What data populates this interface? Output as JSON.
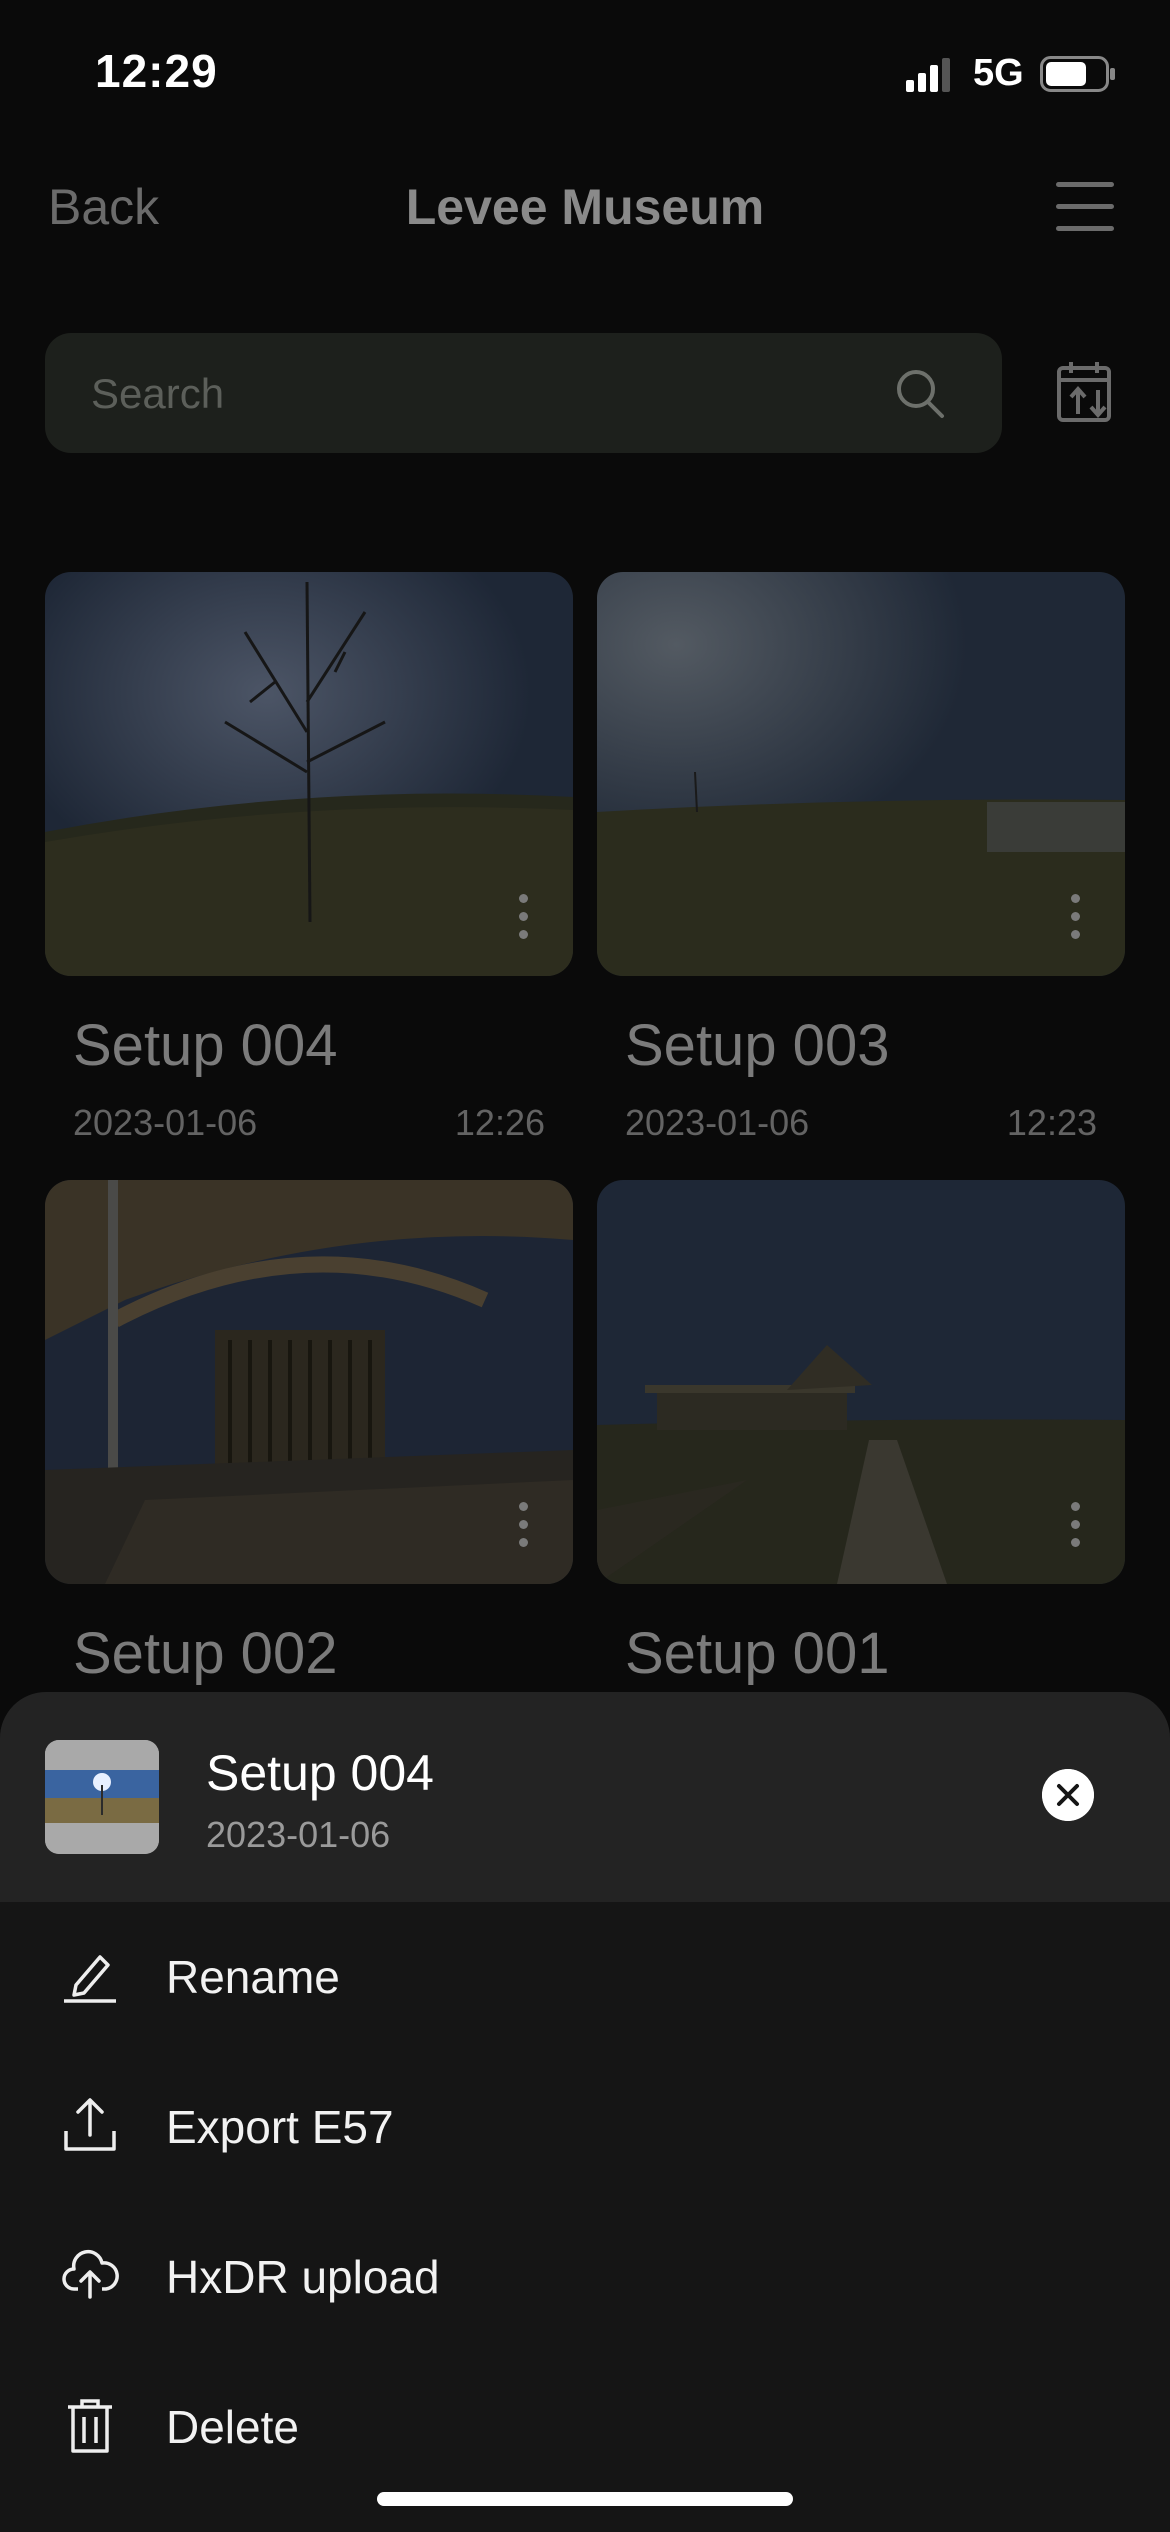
{
  "status_bar": {
    "time": "12:29",
    "network": "5G",
    "battery_level": 0.7
  },
  "nav": {
    "back_label": "Back",
    "title": "Levee Museum",
    "menu_icon": "hamburger-menu-icon"
  },
  "search": {
    "placeholder": "Search",
    "icon": "search-icon",
    "sort_icon": "calendar-sort-icon"
  },
  "setups": [
    {
      "name": "Setup 004",
      "date": "2023-01-06",
      "time": "12:26"
    },
    {
      "name": "Setup 003",
      "date": "2023-01-06",
      "time": "12:23"
    },
    {
      "name": "Setup 002"
    },
    {
      "name": "Setup 001"
    }
  ],
  "sheet": {
    "title": "Setup 004",
    "date": "2023-01-06",
    "close_icon": "close-icon",
    "actions": [
      {
        "label": "Rename",
        "icon": "pencil-icon"
      },
      {
        "label": "Export E57",
        "icon": "upload-icon"
      },
      {
        "label": "HxDR upload",
        "icon": "cloud-upload-icon"
      },
      {
        "label": "Delete",
        "icon": "trash-icon"
      }
    ]
  }
}
